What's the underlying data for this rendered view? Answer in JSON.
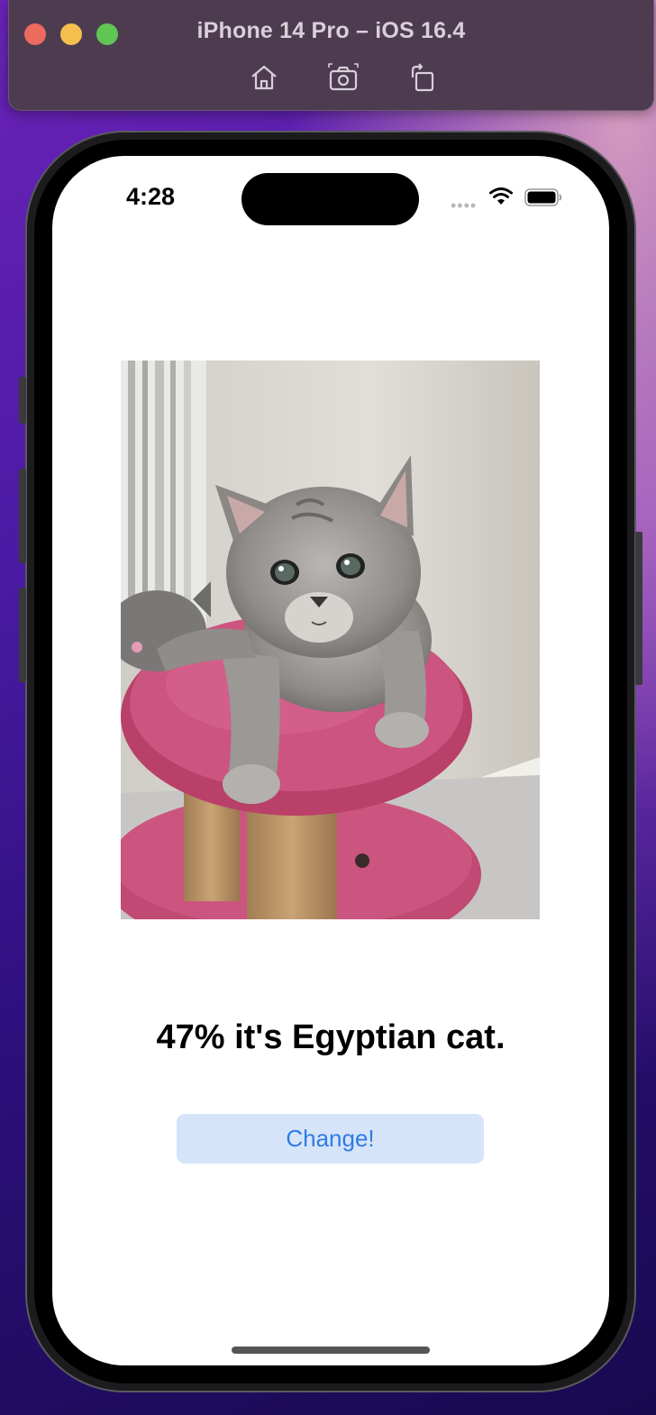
{
  "window": {
    "title": "iPhone 14 Pro – iOS 16.4",
    "toolbar_icons": [
      "home-icon",
      "screenshot-icon",
      "rotate-icon"
    ]
  },
  "status_bar": {
    "time": "4:28",
    "signal_dots": "••••",
    "icons": [
      "wifi-icon",
      "battery-icon"
    ]
  },
  "main": {
    "image_subject": "kitten on pink cat tree",
    "result_text": "47% it's Egyptian cat.",
    "change_button_label": "Change!"
  },
  "colors": {
    "button_bg": "#d6e4f9",
    "button_text": "#2f7ce4",
    "traffic_red": "#ed6a5e",
    "traffic_yellow": "#f5bf4f",
    "traffic_green": "#61c554"
  }
}
